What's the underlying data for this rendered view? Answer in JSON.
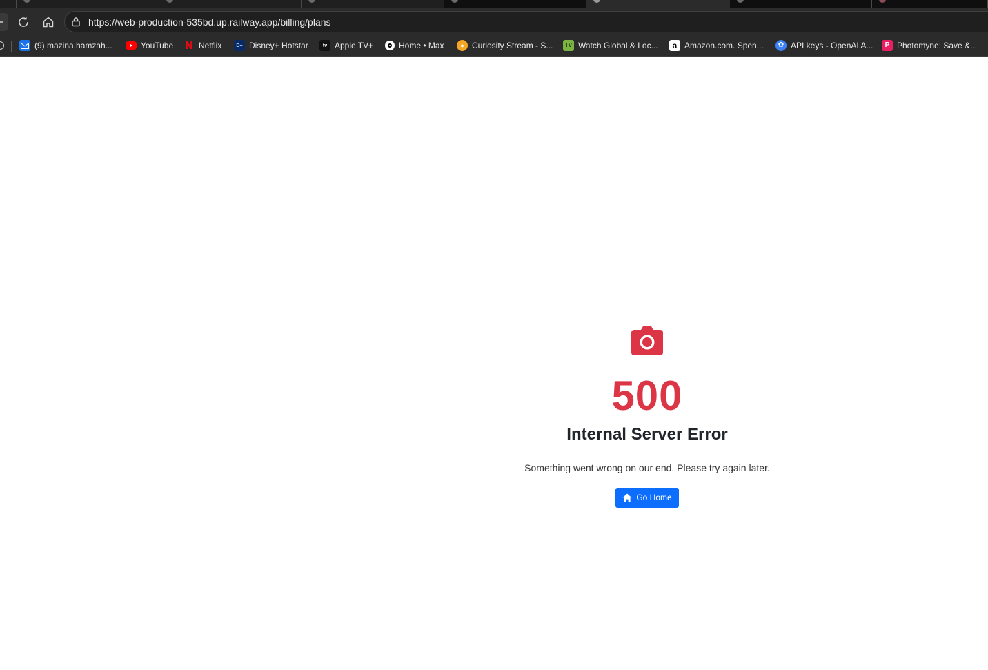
{
  "browser": {
    "url": "https://web-production-535bd.up.railway.app/billing/plans"
  },
  "bookmarks": [
    {
      "label": "(9) mazina.hamzah...",
      "icon": "mail-icon",
      "color": "#1a73e8"
    },
    {
      "label": "YouTube",
      "icon": "youtube-icon",
      "color": "#ff0000"
    },
    {
      "label": "Netflix",
      "icon": "netflix-icon",
      "color": "#e50914"
    },
    {
      "label": "Disney+ Hotstar",
      "icon": "disney-hotstar-icon",
      "color": "#0b2a63"
    },
    {
      "label": "Apple TV+",
      "icon": "apple-tv-icon",
      "color": "#000000"
    },
    {
      "label": "Home • Max",
      "icon": "max-icon",
      "color": "#000000"
    },
    {
      "label": "Curiosity Stream - S...",
      "icon": "curiosity-stream-icon",
      "color": "#f5a623"
    },
    {
      "label": "Watch Global & Loc...",
      "icon": "tv-icon",
      "color": "#7cb342"
    },
    {
      "label": "Amazon.com. Spen...",
      "icon": "amazon-icon",
      "color": "#ffffff"
    },
    {
      "label": "API keys - OpenAI A...",
      "icon": "openai-icon",
      "color": "#3b82f6"
    },
    {
      "label": "Photomyne: Save &...",
      "icon": "photomyne-icon",
      "color": "#e91e63"
    }
  ],
  "error": {
    "icon": "camera-icon",
    "code": "500",
    "title": "Internal Server Error",
    "message": "Something went wrong on our end. Please try again later.",
    "button_label": "Go Home",
    "accent_color": "#dc3545",
    "button_color": "#0d6efd"
  }
}
